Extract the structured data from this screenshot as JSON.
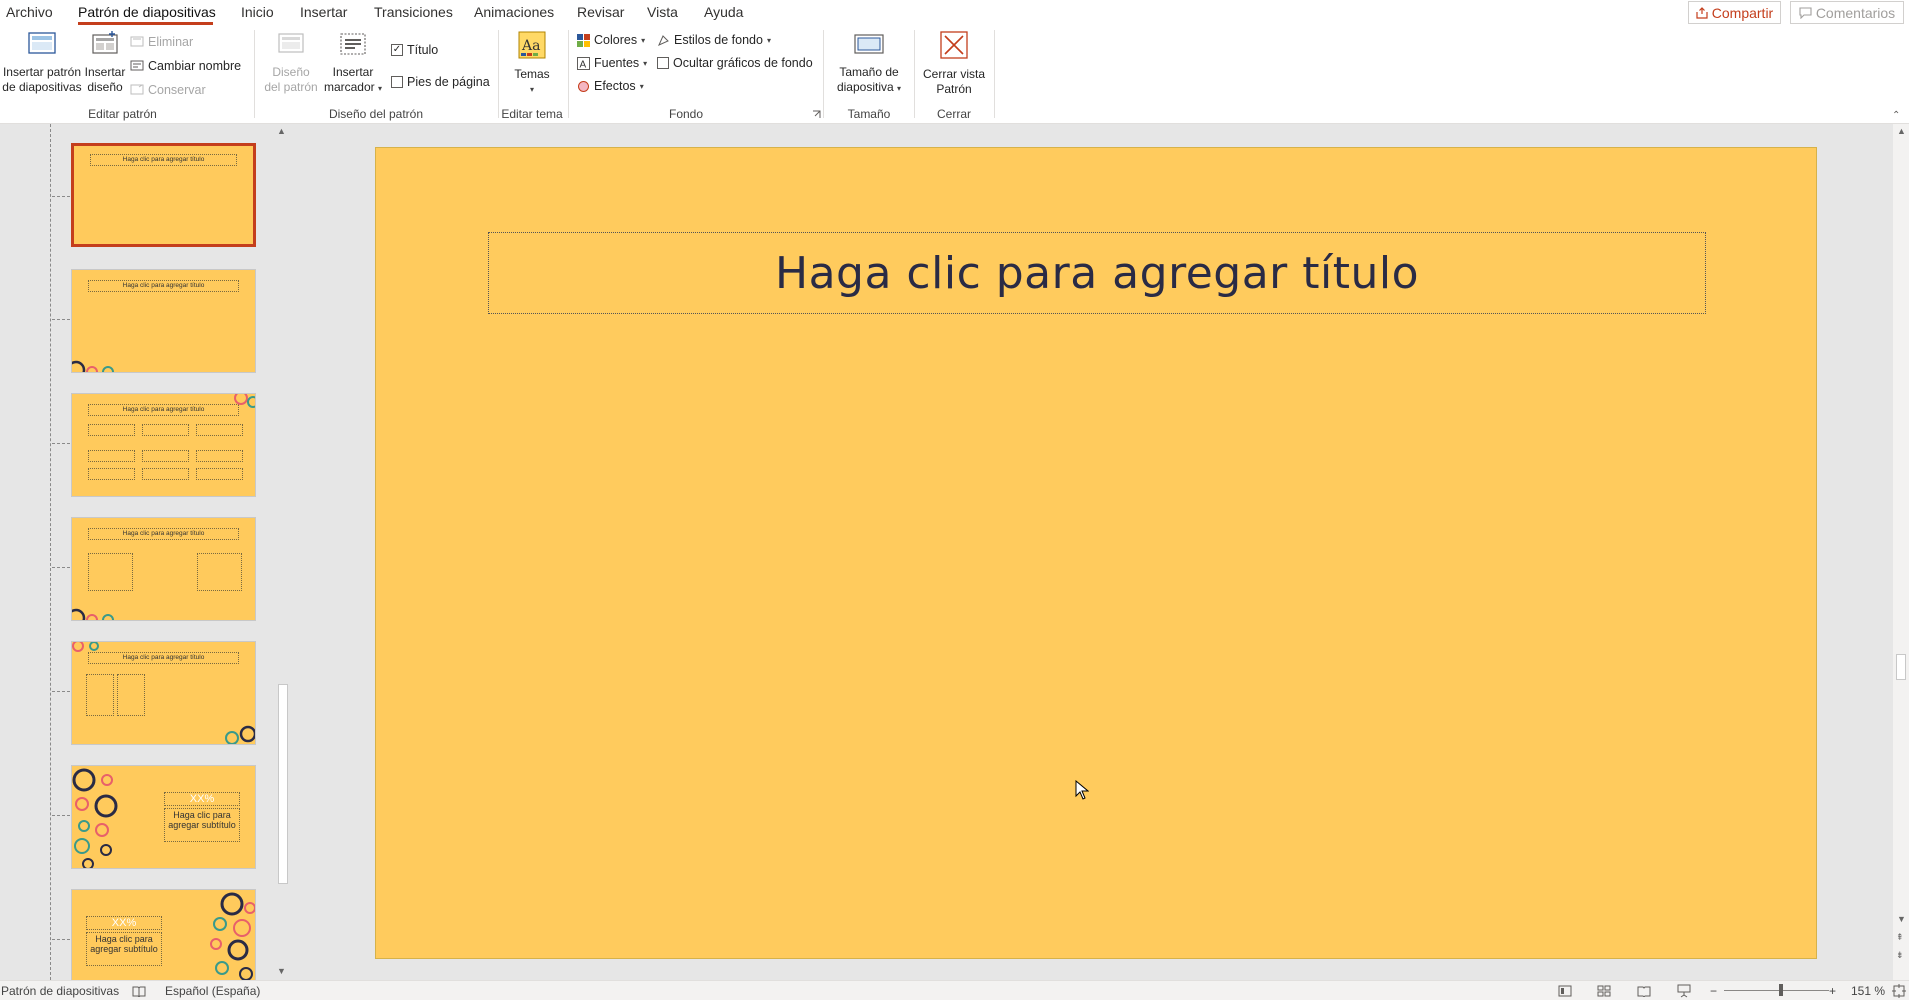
{
  "tabs": [
    {
      "label": "Archivo"
    },
    {
      "label": "Patrón de diapositivas",
      "active": true
    },
    {
      "label": "Inicio"
    },
    {
      "label": "Insertar"
    },
    {
      "label": "Transiciones"
    },
    {
      "label": "Animaciones"
    },
    {
      "label": "Revisar"
    },
    {
      "label": "Vista"
    },
    {
      "label": "Ayuda"
    }
  ],
  "share_label": "Compartir",
  "comments_label": "Comentarios",
  "ribbon": {
    "editar_patron": {
      "group_label": "Editar patrón",
      "insert_master_line1": "Insertar patrón",
      "insert_master_line2": "de diapositivas",
      "insert_layout_line1": "Insertar",
      "insert_layout_line2": "diseño",
      "delete_label": "Eliminar",
      "rename_label": "Cambiar nombre",
      "preserve_label": "Conservar"
    },
    "diseno_patron": {
      "group_label": "Diseño del patrón",
      "master_layout_line1": "Diseño",
      "master_layout_line2": "del patrón",
      "insert_placeholder_line1": "Insertar",
      "insert_placeholder_line2": "marcador",
      "title_checkbox": "Título",
      "title_checked": true,
      "footer_checkbox": "Pies de página",
      "footer_checked": false
    },
    "editar_tema": {
      "group_label": "Editar tema",
      "themes_label": "Temas"
    },
    "fondo": {
      "group_label": "Fondo",
      "colors_label": "Colores",
      "fonts_label": "Fuentes",
      "effects_label": "Efectos",
      "bg_styles_label": "Estilos de fondo",
      "hide_bg_label": "Ocultar gráficos de fondo",
      "hide_bg_checked": false
    },
    "tamano": {
      "group_label": "Tamaño",
      "slide_size_line1": "Tamaño de",
      "slide_size_line2": "diapositiva"
    },
    "cerrar": {
      "group_label": "Cerrar",
      "close_line1": "Cerrar vista",
      "close_line2": "Patrón"
    }
  },
  "thumbnails": [
    {
      "title": "Haga clic para agregar título",
      "selected": true
    },
    {
      "title": "Haga clic para agregar título"
    },
    {
      "title": "Haga clic para agregar título"
    },
    {
      "title": "Haga clic para agregar título"
    },
    {
      "title": "Haga clic para agregar título"
    },
    {
      "heading": "XX%",
      "subtitle": "Haga clic para agregar subtítulo"
    },
    {
      "heading": "XX%",
      "subtitle": "Haga clic para agregar subtítulo"
    }
  ],
  "slide": {
    "title_placeholder": "Haga clic para agregar título",
    "background": "#ffcb5d",
    "title_color": "#2a2b45"
  },
  "status": {
    "mode": "Patrón de diapositivas",
    "language": "Español (España)",
    "zoom": "151 %"
  },
  "accent": "#c43e1c"
}
